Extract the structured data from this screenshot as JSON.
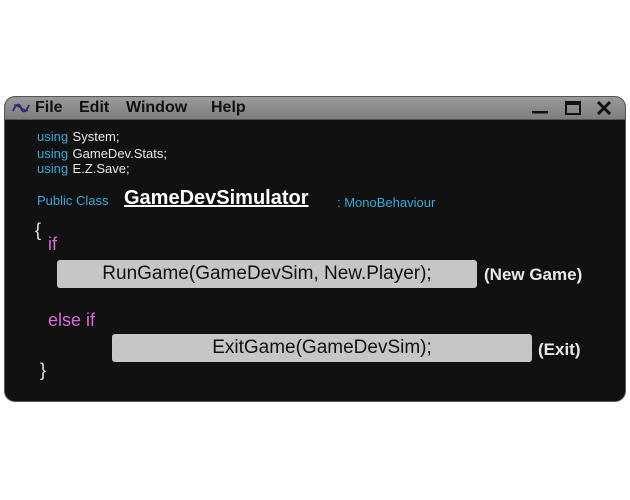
{
  "menu": {
    "items": [
      "File",
      "Edit",
      "Window",
      "Help"
    ]
  },
  "window_controls": [
    "minimize-icon",
    "maximize-icon",
    "close-icon"
  ],
  "code": {
    "usings": [
      {
        "keyword": "using",
        "name": "System;"
      },
      {
        "keyword": "using",
        "name": "GameDev.Stats;"
      },
      {
        "keyword": "using",
        "name": "E.Z.Save;"
      }
    ],
    "class_keyword": "Public Class",
    "class_name": "GameDevSimulator",
    "base_class": ": MonoBehaviour",
    "open_brace": "{",
    "close_brace": "}",
    "if_keyword": "if",
    "else_if_keyword": "else if"
  },
  "actions": {
    "run": {
      "code": "RunGame(GameDevSim, New.Player);",
      "label": "(New Game)"
    },
    "exit": {
      "code": "ExitGame(GameDevSim);",
      "label": "(Exit)"
    }
  },
  "colors": {
    "background": "#111111",
    "menubar": "#8c8c8c",
    "keyword_blue": "#3aa8d6",
    "keyword_pink": "#d86bd8",
    "button_gray": "#c6c6c6"
  }
}
